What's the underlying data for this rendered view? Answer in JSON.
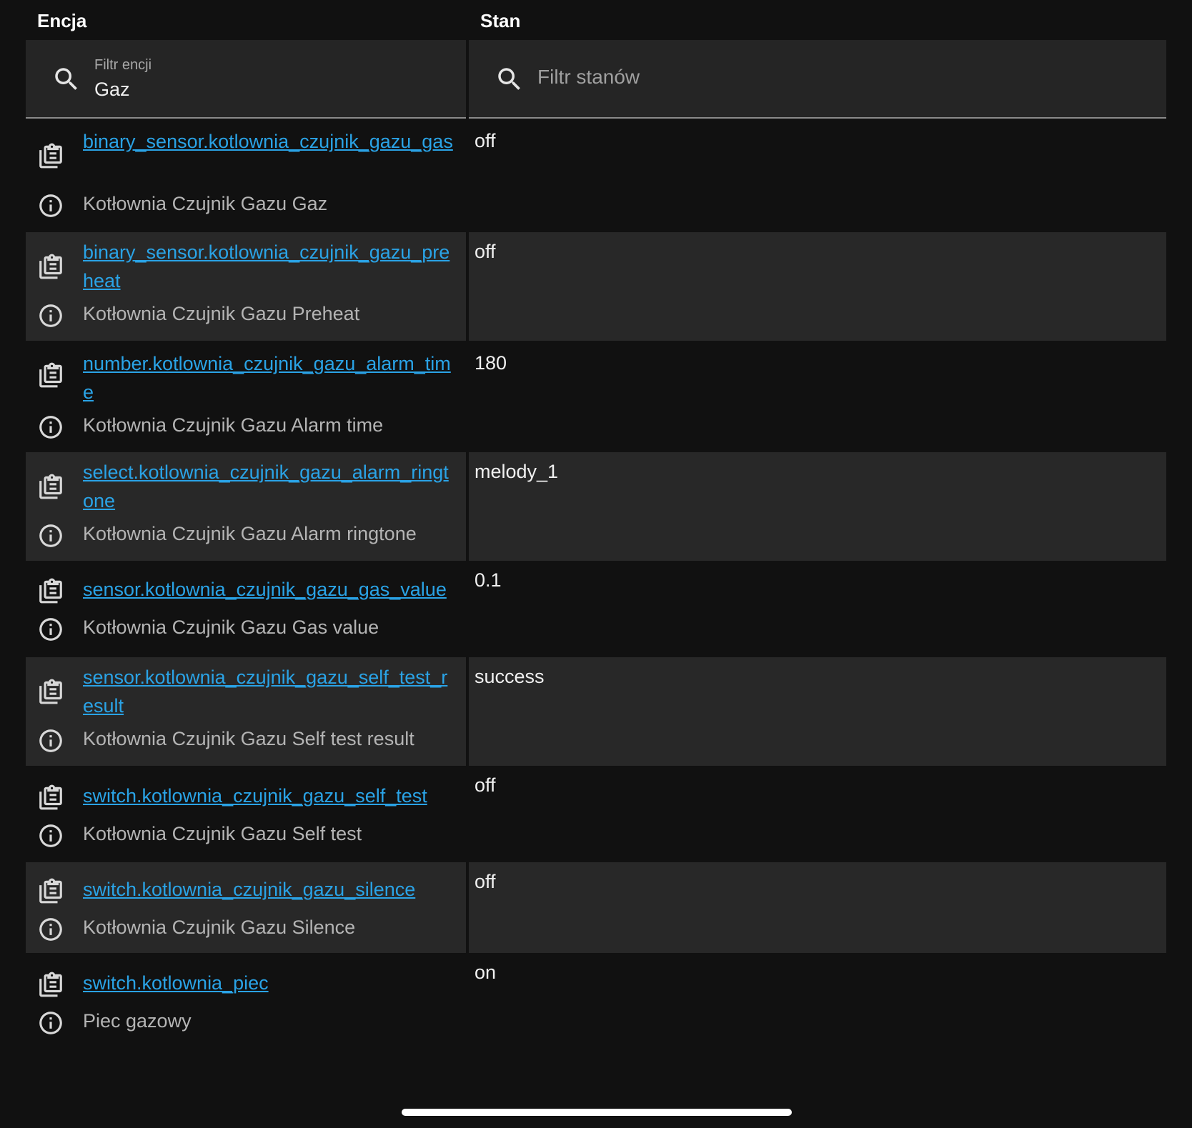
{
  "columns": {
    "entity": "Encja",
    "state": "Stan"
  },
  "filters": {
    "entity": {
      "label": "Filtr encji",
      "value": "Gaz",
      "icon": "search-icon"
    },
    "state": {
      "placeholder": "Filtr stanów",
      "icon": "search-icon"
    }
  },
  "rows": [
    {
      "entity_id": "binary_sensor.kotlownia_czujnik_gazu_gas",
      "name": "Kotłownia Czujnik Gazu Gaz",
      "state": "off"
    },
    {
      "entity_id": "binary_sensor.kotlownia_czujnik_gazu_preheat",
      "name": "Kotłownia Czujnik Gazu Preheat",
      "state": "off"
    },
    {
      "entity_id": "number.kotlownia_czujnik_gazu_alarm_time",
      "name": "Kotłownia Czujnik Gazu Alarm time",
      "state": "180"
    },
    {
      "entity_id": "select.kotlownia_czujnik_gazu_alarm_ringtone",
      "name": "Kotłownia Czujnik Gazu Alarm ringtone",
      "state": "melody_1"
    },
    {
      "entity_id": "sensor.kotlownia_czujnik_gazu_gas_value",
      "name": "Kotłownia Czujnik Gazu Gas value",
      "state": "0.1"
    },
    {
      "entity_id": "sensor.kotlownia_czujnik_gazu_self_test_result",
      "name": "Kotłownia Czujnik Gazu Self test result",
      "state": "success"
    },
    {
      "entity_id": "switch.kotlownia_czujnik_gazu_self_test",
      "name": "Kotłownia Czujnik Gazu Self test",
      "state": "off"
    },
    {
      "entity_id": "switch.kotlownia_czujnik_gazu_silence",
      "name": "Kotłownia Czujnik Gazu Silence",
      "state": "off"
    },
    {
      "entity_id": "switch.kotlownia_piec",
      "name": "Piec gazowy",
      "state": "on"
    }
  ],
  "colors": {
    "background": "#111111",
    "row_alt": "#282828",
    "link": "#2aa3e6",
    "secondary_text": "#b4b4b4"
  }
}
